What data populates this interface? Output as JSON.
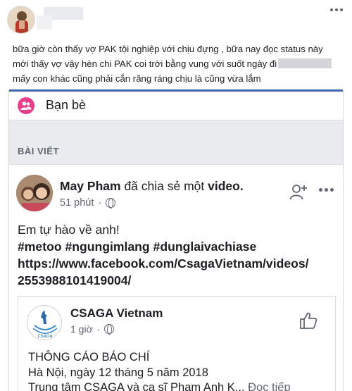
{
  "outer_post": {
    "status_lines": [
      "bữa giờ còn thấy vợ PAK tội nghiệp với chịu đựng , bữa nay đọc status này",
      "mới thấy vợ vậy hèn chi PAK coi trời bằng vung với suốt ngày đi",
      "mấy con khác cũng phải cắn răng ráng chịu là cũng vừa lắm"
    ]
  },
  "screenshot": {
    "friends_label": "Bạn bè",
    "section_label": "BÀI VIẾT",
    "inner_post": {
      "author": "May Pham",
      "action": "đã chia sẻ một",
      "object": "video.",
      "time": "51 phút",
      "separator": "·",
      "body_line1": "Em tự hào về anh!",
      "body_tags": "#metoo #ngungimlang #dunglaivachiase",
      "body_link_line1": "https://www.facebook.com/CsagaVietnam/videos/",
      "body_link_line2": "2553988101419004/"
    },
    "shared_post": {
      "page_name": "CSAGA Vietnam",
      "time": "1 giờ",
      "separator": "·",
      "logo_text": "CSAGA",
      "line1": "THÔNG CÁO BÁO CHÍ",
      "line2": "Hà Nội, ngày 12 tháng 5 năm 2018",
      "line3": "Trung tâm CSAGA và ca sĩ Phạm Anh K...",
      "read_more": "Đọc tiếp"
    }
  },
  "colors": {
    "accent_blue": "#4267b2",
    "friends_pink": "#e83e8c",
    "muted_text": "#606770"
  }
}
